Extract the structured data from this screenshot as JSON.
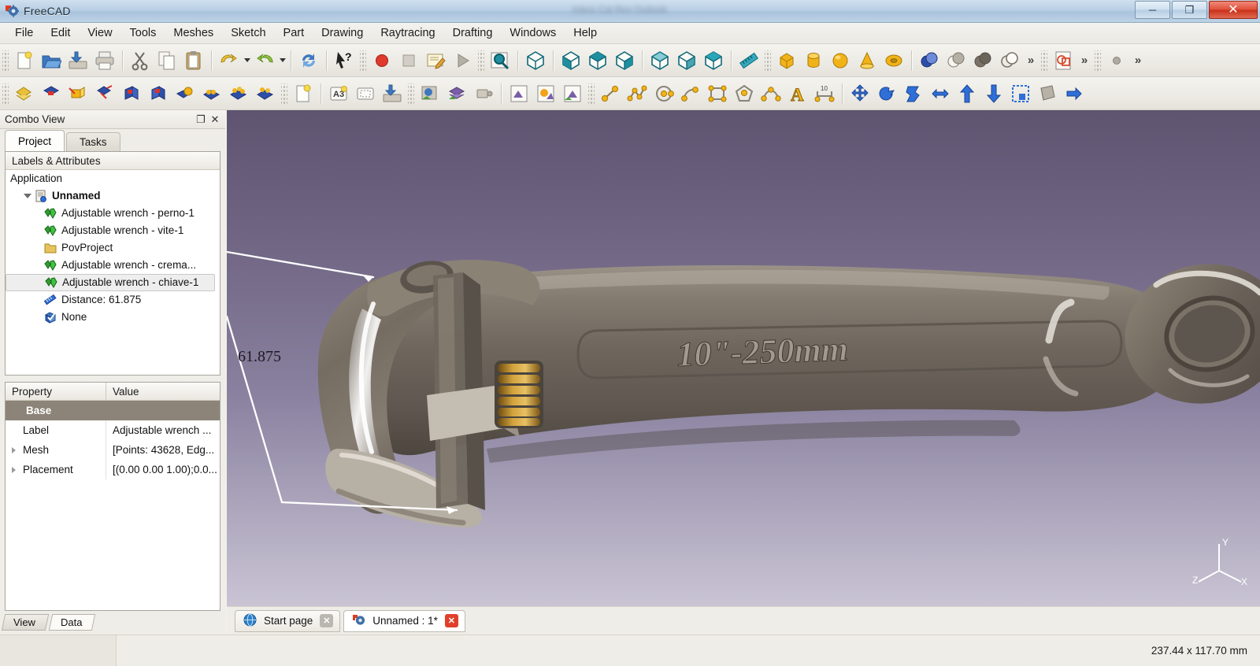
{
  "window": {
    "app_title": "FreeCAD",
    "blurred_center_text": "Inbox  Cal Rev  Outlook",
    "buttons": {
      "minimize": "─",
      "maximize": "❐",
      "close": "✕"
    },
    "icons": {
      "app": "freecad-icon",
      "minimize": "minimize-icon",
      "maximize": "maximize-icon",
      "close": "close-icon"
    }
  },
  "menubar": {
    "items": [
      {
        "label": "File"
      },
      {
        "label": "Edit"
      },
      {
        "label": "View"
      },
      {
        "label": "Tools"
      },
      {
        "label": "Meshes"
      },
      {
        "label": "Sketch"
      },
      {
        "label": "Part"
      },
      {
        "label": "Drawing"
      },
      {
        "label": "Raytracing"
      },
      {
        "label": "Drafting"
      },
      {
        "label": "Windows"
      },
      {
        "label": "Help"
      }
    ]
  },
  "toolbars": {
    "row1": [
      {
        "type": "grip"
      },
      {
        "type": "button",
        "name": "new-document-icon"
      },
      {
        "type": "button",
        "name": "open-document-icon"
      },
      {
        "type": "button",
        "name": "save-document-icon"
      },
      {
        "type": "button",
        "name": "print-icon"
      },
      {
        "type": "sep"
      },
      {
        "type": "button",
        "name": "cut-icon"
      },
      {
        "type": "button",
        "name": "copy-icon"
      },
      {
        "type": "button",
        "name": "paste-icon"
      },
      {
        "type": "sep"
      },
      {
        "type": "button",
        "name": "undo-icon"
      },
      {
        "type": "dropdown",
        "name": "undo-dropdown-icon"
      },
      {
        "type": "button",
        "name": "redo-icon"
      },
      {
        "type": "dropdown",
        "name": "redo-dropdown-icon"
      },
      {
        "type": "sep"
      },
      {
        "type": "button",
        "name": "refresh-icon"
      },
      {
        "type": "sep"
      },
      {
        "type": "button",
        "name": "whats-this-icon"
      },
      {
        "type": "grip"
      },
      {
        "type": "button",
        "name": "macro-record-icon"
      },
      {
        "type": "button",
        "name": "macro-stop-icon"
      },
      {
        "type": "button",
        "name": "macro-edit-icon"
      },
      {
        "type": "button",
        "name": "macro-execute-icon"
      },
      {
        "type": "grip"
      },
      {
        "type": "button",
        "name": "fit-all-icon"
      },
      {
        "type": "sep"
      },
      {
        "type": "button",
        "name": "axonometric-view-icon"
      },
      {
        "type": "sep"
      },
      {
        "type": "button",
        "name": "front-view-icon"
      },
      {
        "type": "button",
        "name": "top-view-icon"
      },
      {
        "type": "button",
        "name": "right-view-icon"
      },
      {
        "type": "sep"
      },
      {
        "type": "button",
        "name": "rear-view-icon"
      },
      {
        "type": "button",
        "name": "bottom-view-icon"
      },
      {
        "type": "button",
        "name": "left-view-icon"
      },
      {
        "type": "sep"
      },
      {
        "type": "button",
        "name": "measure-distance-icon"
      },
      {
        "type": "grip"
      },
      {
        "type": "button",
        "name": "box-primitive-icon"
      },
      {
        "type": "button",
        "name": "cylinder-primitive-icon"
      },
      {
        "type": "button",
        "name": "sphere-primitive-icon"
      },
      {
        "type": "button",
        "name": "cone-primitive-icon"
      },
      {
        "type": "button",
        "name": "torus-primitive-icon"
      },
      {
        "type": "sep"
      },
      {
        "type": "button",
        "name": "boolean-union-icon"
      },
      {
        "type": "button",
        "name": "boolean-cut-icon"
      },
      {
        "type": "button",
        "name": "boolean-common-icon"
      },
      {
        "type": "button",
        "name": "boolean-section-icon"
      },
      {
        "type": "chevron",
        "label": "»"
      },
      {
        "type": "grip"
      },
      {
        "type": "button",
        "name": "draft-to-sketch-icon"
      },
      {
        "type": "chevron",
        "label": "»"
      },
      {
        "type": "grip"
      },
      {
        "type": "button",
        "name": "point-icon"
      },
      {
        "type": "chevron",
        "label": "»"
      }
    ],
    "row2": [
      {
        "type": "grip"
      },
      {
        "type": "button",
        "name": "mesh-import-icon"
      },
      {
        "type": "button",
        "name": "mesh-export-icon"
      },
      {
        "type": "button",
        "name": "mesh-scale-icon"
      },
      {
        "type": "button",
        "name": "mesh-transform-icon"
      },
      {
        "type": "button",
        "name": "mesh-cut-icon"
      },
      {
        "type": "button",
        "name": "mesh-trim-icon"
      },
      {
        "type": "button",
        "name": "mesh-boolean-union-icon"
      },
      {
        "type": "button",
        "name": "mesh-boolean-difference-icon"
      },
      {
        "type": "button",
        "name": "mesh-evaluate-icon"
      },
      {
        "type": "button",
        "name": "mesh-refinement-icon"
      },
      {
        "type": "grip"
      },
      {
        "type": "button",
        "name": "drawing-new-page-icon"
      },
      {
        "type": "sep"
      },
      {
        "type": "button",
        "name": "drawing-a3-page-icon"
      },
      {
        "type": "button",
        "name": "drawing-insert-view-icon"
      },
      {
        "type": "button",
        "name": "drawing-export-icon"
      },
      {
        "type": "grip"
      },
      {
        "type": "button",
        "name": "raytracing-new-povproject-icon"
      },
      {
        "type": "button",
        "name": "raytracing-insert-part-icon"
      },
      {
        "type": "button",
        "name": "raytracing-camera-icon"
      },
      {
        "type": "sep"
      },
      {
        "type": "button",
        "name": "raytracing-render-icon"
      },
      {
        "type": "button",
        "name": "raytracing-luxrender-icon"
      },
      {
        "type": "button",
        "name": "raytracing-export-icon"
      },
      {
        "type": "grip"
      },
      {
        "type": "button",
        "name": "draft-line-icon"
      },
      {
        "type": "button",
        "name": "draft-wire-icon"
      },
      {
        "type": "button",
        "name": "draft-circle-icon"
      },
      {
        "type": "button",
        "name": "draft-arc-icon"
      },
      {
        "type": "button",
        "name": "draft-rectangle-icon"
      },
      {
        "type": "button",
        "name": "draft-polygon-icon"
      },
      {
        "type": "button",
        "name": "draft-bspline-icon"
      },
      {
        "type": "button",
        "name": "draft-text-icon"
      },
      {
        "type": "button",
        "name": "draft-dimension-icon"
      },
      {
        "type": "sep"
      },
      {
        "type": "button",
        "name": "draft-move-icon"
      },
      {
        "type": "button",
        "name": "draft-rotate-icon"
      },
      {
        "type": "button",
        "name": "draft-offset-icon"
      },
      {
        "type": "button",
        "name": "draft-trimex-icon"
      },
      {
        "type": "button",
        "name": "draft-upgrade-icon"
      },
      {
        "type": "button",
        "name": "draft-downgrade-icon"
      },
      {
        "type": "button",
        "name": "draft-scale-icon"
      },
      {
        "type": "button",
        "name": "draft-shape2dview-icon"
      },
      {
        "type": "button",
        "name": "draft-drawing-icon"
      }
    ]
  },
  "combo_view": {
    "title": "Combo View",
    "float_glyph": "❐",
    "close_glyph": "✕",
    "tabs": [
      {
        "label": "Project",
        "active": true
      },
      {
        "label": "Tasks",
        "active": false
      }
    ],
    "tree_header": "Labels & Attributes",
    "tree": [
      {
        "label": "Application",
        "level": 0,
        "icon": "none",
        "expander": "none",
        "bold": false,
        "selected": false
      },
      {
        "label": "Unnamed",
        "level": 1,
        "icon": "document-icon",
        "expander": "open",
        "bold": true,
        "selected": false
      },
      {
        "label": "Adjustable wrench - perno-1",
        "level": 2,
        "icon": "mesh-icon",
        "expander": "none",
        "bold": false,
        "selected": false
      },
      {
        "label": "Adjustable wrench - vite-1",
        "level": 2,
        "icon": "mesh-icon",
        "expander": "none",
        "bold": false,
        "selected": false
      },
      {
        "label": "PovProject",
        "level": 2,
        "icon": "folder-icon",
        "expander": "none",
        "bold": false,
        "selected": false
      },
      {
        "label": "Adjustable wrench - crema...",
        "level": 2,
        "icon": "mesh-icon",
        "expander": "none",
        "bold": false,
        "selected": false
      },
      {
        "label": "Adjustable wrench - chiave-1",
        "level": 2,
        "icon": "mesh-icon",
        "expander": "none",
        "bold": false,
        "selected": true
      },
      {
        "label": "Distance: 61.875",
        "level": 2,
        "icon": "measure-icon",
        "expander": "none",
        "bold": false,
        "selected": false
      },
      {
        "label": "None",
        "level": 2,
        "icon": "none-icon",
        "expander": "none",
        "bold": false,
        "selected": false
      }
    ],
    "property_headers": {
      "property": "Property",
      "value": "Value"
    },
    "properties": [
      {
        "name": "Base",
        "value": "",
        "group": true,
        "expandable": false
      },
      {
        "name": "Label",
        "value": "Adjustable wrench ...",
        "group": false,
        "expandable": false
      },
      {
        "name": "Mesh",
        "value": "[Points: 43628, Edg...",
        "group": false,
        "expandable": true
      },
      {
        "name": "Placement",
        "value": "[(0.00 0.00 1.00);0.0...",
        "group": false,
        "expandable": true
      }
    ],
    "bottom_tabs": [
      {
        "label": "View",
        "active": false
      },
      {
        "label": "Data",
        "active": true
      }
    ]
  },
  "view3d": {
    "dimension_label": "61.875",
    "model_text": "10\"-250mm",
    "axis_labels": {
      "x": "X",
      "y": "Y",
      "z": "Z"
    },
    "background_top_color": "#5f5470",
    "background_bottom_color": "#c9c4d4"
  },
  "view_tabs": [
    {
      "label": "Start page",
      "active": false,
      "icon": "globe-icon",
      "close": "✕"
    },
    {
      "label": "Unnamed : 1*",
      "active": true,
      "icon": "freecad-icon",
      "close": "✕"
    }
  ],
  "statusbar": {
    "dimensions": "237.44 x 117.70 mm"
  }
}
